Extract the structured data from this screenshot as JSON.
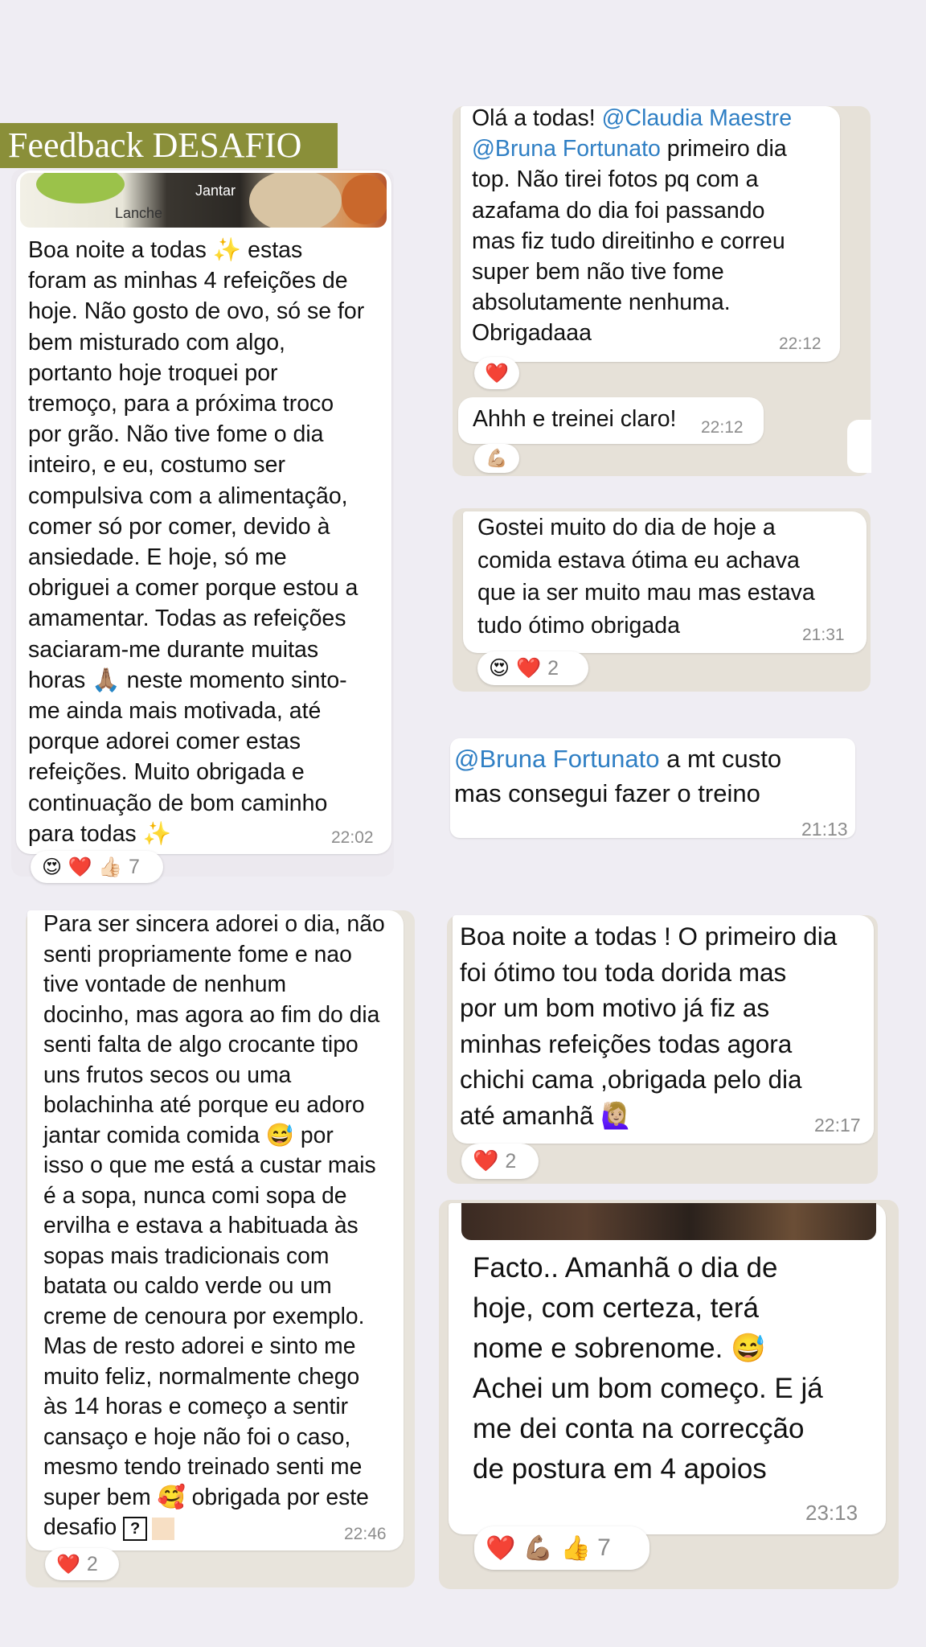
{
  "banner": {
    "title": "Feedback DESAFIO"
  },
  "msg1": {
    "photo_labels": {
      "lanche": "Lanche",
      "jantar": "Jantar"
    },
    "text": "Boa noite a todas ✨ estas\nforam as minhas 4 refeições de\nhoje. Não gosto de ovo, só se for\nbem misturado com algo,\nportanto hoje troquei por\ntremoço, para a próxima troco\npor grão. Não tive fome o dia\ninteiro, e eu, costumo ser\ncompulsiva com a alimentação,\ncomer só por comer, devido à\nansiedade. E hoje, só me\nobriguei a comer porque estou a\namamentar. Todas as refeições\nsaciaram-me durante muitas\nhoras 🙏🏽 neste momento sinto-\nme ainda mais motivada, até\nporque adorei comer estas\nrefeições. Muito obrigada e\ncontinuação de bom caminho\npara todas ✨",
    "time": "22:02",
    "reactions": "😍 ❤️ 👍🏻",
    "reaction_count": "7"
  },
  "msg2": {
    "text_intro": "Olá a todas! ",
    "mention1": "@Claudia Maestre",
    "mention2": "@Bruna Fortunato",
    "text_rest": " primeiro dia\ntop. Não tirei fotos pq com a\nazafama do dia foi passando\nmas fiz tudo direitinho e correu\nsuper bem não tive fome\nabsolutamente nenhuma.\nObrigadaaa",
    "time": "22:12",
    "reaction": "❤️"
  },
  "msg3": {
    "text": "Ahhh e treinei claro!",
    "time": "22:12",
    "reaction": "💪🏼"
  },
  "msg4": {
    "text": "Gostei muito do dia de hoje a\ncomida estava ótima eu achava\nque ia ser muito mau mas estava\ntudo ótimo obrigada",
    "time": "21:31",
    "reactions": "😍 ❤️",
    "reaction_count": "2"
  },
  "msg5": {
    "mention": "@Bruna Fortunato",
    "text": " a mt custo\nmas consegui fazer o treino",
    "time": "21:13"
  },
  "msg6": {
    "text": "Para ser sincera adorei o dia, não\nsenti propriamente fome e nao\ntive vontade de nenhum\ndocinho, mas agora ao fim do dia\nsenti falta de algo crocante tipo\nuns frutos secos ou uma\nbolachinha até porque eu adoro\njantar comida comida 😅 por\nisso o que me está a custar mais\né a sopa, nunca comi sopa de\nervilha e estava a habituada às\nsopas mais tradicionais com\nbatata ou caldo verde ou um\ncreme de cenoura por exemplo.\nMas de resto adorei e sinto me\nmuito feliz, normalmente chego\nàs 14 horas e começo a sentir\ncansaço e hoje não foi o caso,\nmesmo tendo treinado senti me\nsuper bem 🥰 obrigada por este\ndesafio",
    "time": "22:46",
    "reaction": "❤️",
    "reaction_count": "2"
  },
  "msg7": {
    "text": "Boa noite a todas ! O primeiro dia\nfoi ótimo tou toda dorida mas\npor um bom motivo já fiz as\nminhas refeições todas agora\nchichi cama ,obrigada pelo dia\naté amanhã 🙋🏼‍♀️",
    "time": "22:17",
    "reaction": "❤️",
    "reaction_count": "2"
  },
  "msg8": {
    "text": "Facto.. Amanhã o dia de\nhoje, com certeza, terá\nnome e sobrenome. 😅\nAchei um bom  começo. E já\nme dei conta na correcção\nde postura em 4 apoios",
    "time": "23:13",
    "reactions": "❤️ 💪🏽 👍",
    "reaction_count": "7"
  }
}
